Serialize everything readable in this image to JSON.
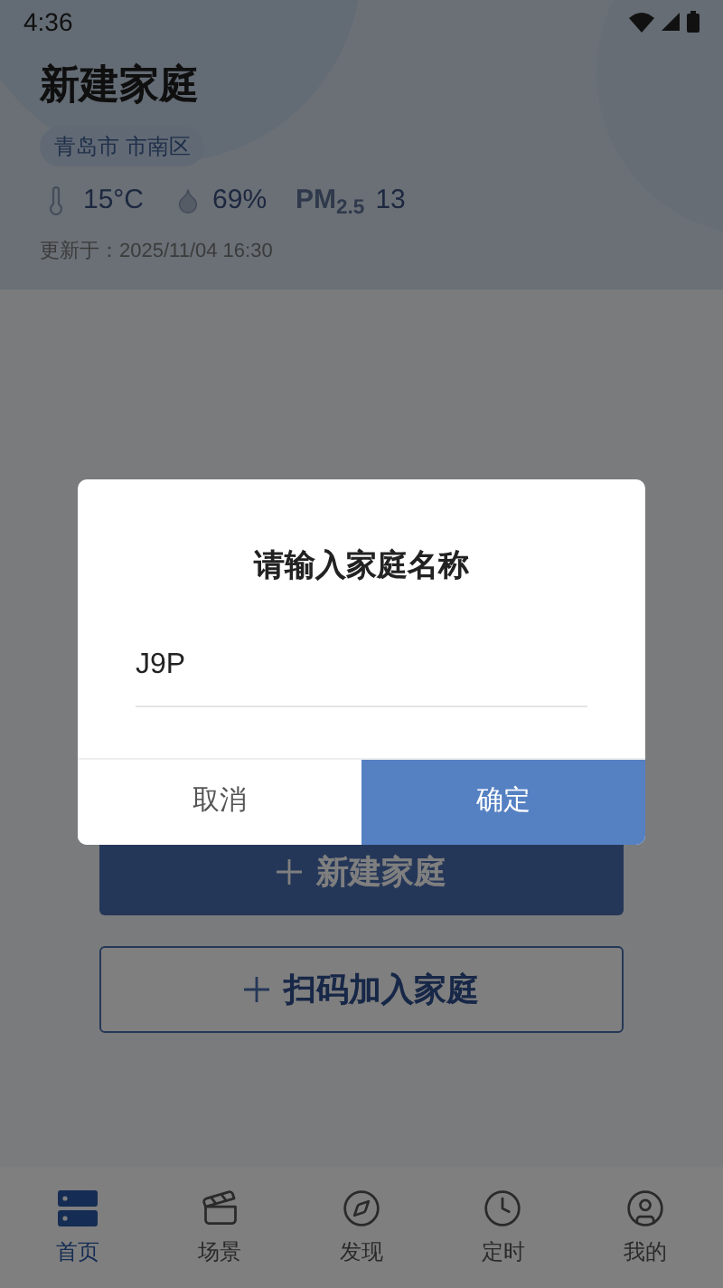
{
  "status_bar": {
    "time": "4:36"
  },
  "header": {
    "title": "新建家庭",
    "location": "青岛市 市南区",
    "weather": [
      {
        "kind": "temperature",
        "value": "15°C"
      },
      {
        "kind": "humidity",
        "value": "69%"
      },
      {
        "kind": "pm",
        "label": "PM$_{2.5}$",
        "value": "13"
      }
    ],
    "updated": "更新于：2025/11/04 16:30"
  },
  "actions": [
    {
      "kind": "primary",
      "label": "新建家庭"
    },
    {
      "kind": "outline",
      "label": "扫码加入家庭"
    }
  ],
  "dialog": {
    "title": "请输入家庭名称",
    "value": "J9P",
    "buttons": [
      {
        "kind": "cancel",
        "label": "取消"
      },
      {
        "kind": "confirm",
        "label": "确定"
      }
    ]
  },
  "tabs": [
    {
      "kind": "home",
      "label": "首页",
      "selected": true
    },
    {
      "kind": "scene",
      "label": "场景",
      "selected": false
    },
    {
      "kind": "discover",
      "label": "发现",
      "selected": false
    },
    {
      "kind": "timer",
      "label": "定时",
      "selected": false
    },
    {
      "kind": "me",
      "label": "我的",
      "selected": false
    }
  ]
}
